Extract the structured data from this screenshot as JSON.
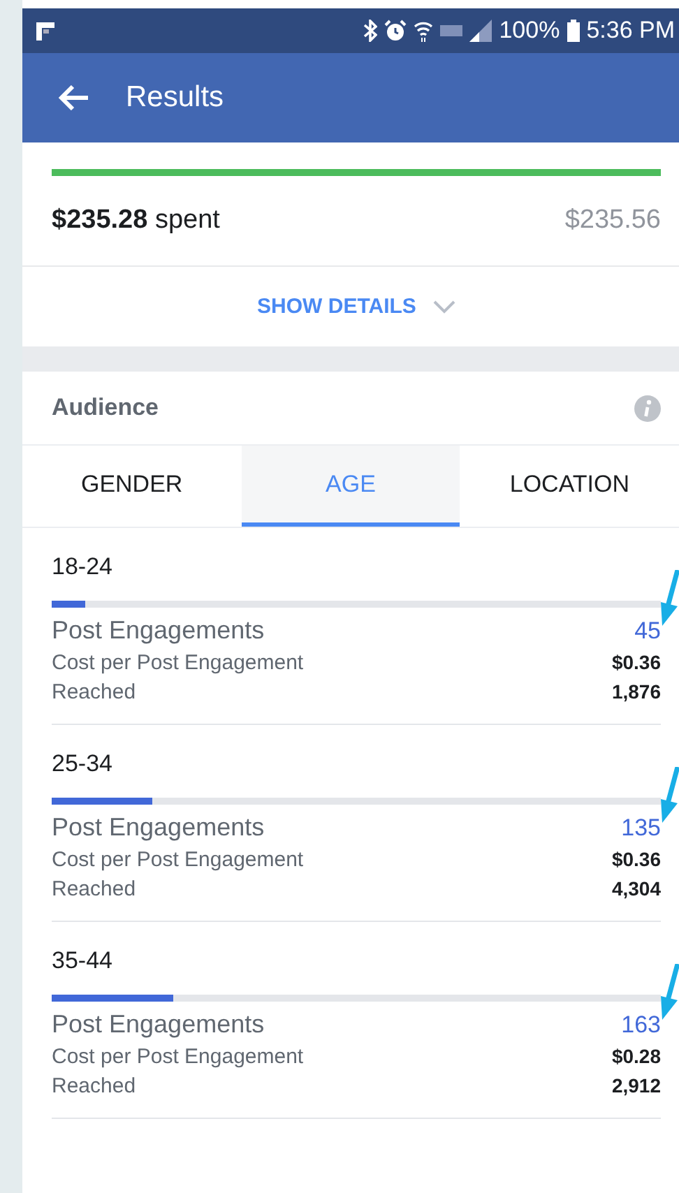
{
  "status_bar": {
    "battery": "100%",
    "time": "5:36 PM"
  },
  "app_bar": {
    "title": "Results"
  },
  "budget": {
    "spent": "$235.28",
    "spent_label": "spent",
    "total": "$235.56",
    "level": 1.0,
    "details_button": "SHOW DETAILS"
  },
  "audience": {
    "title": "Audience",
    "tabs": [
      {
        "label": "GENDER",
        "selected": false
      },
      {
        "label": "AGE",
        "selected": true
      },
      {
        "label": "LOCATION",
        "selected": false
      }
    ],
    "groups": [
      {
        "label": "18-24",
        "level": 0.055,
        "annotated": true,
        "engagements_label": "Post Engagements",
        "engagements": "45",
        "cost_label": "Cost per Post Engagement",
        "cost": "$0.36",
        "reached_label": "Reached",
        "reached": "1,876"
      },
      {
        "label": "25-34",
        "level": 0.165,
        "annotated": true,
        "engagements_label": "Post Engagements",
        "engagements": "135",
        "cost_label": "Cost per Post Engagement",
        "cost": "$0.36",
        "reached_label": "Reached",
        "reached": "4,304"
      },
      {
        "label": "35-44",
        "level": 0.2,
        "annotated": true,
        "engagements_label": "Post Engagements",
        "engagements": "163",
        "cost_label": "Cost per Post Engagement",
        "cost": "$0.28",
        "reached_label": "Reached",
        "reached": "2,912"
      }
    ]
  }
}
